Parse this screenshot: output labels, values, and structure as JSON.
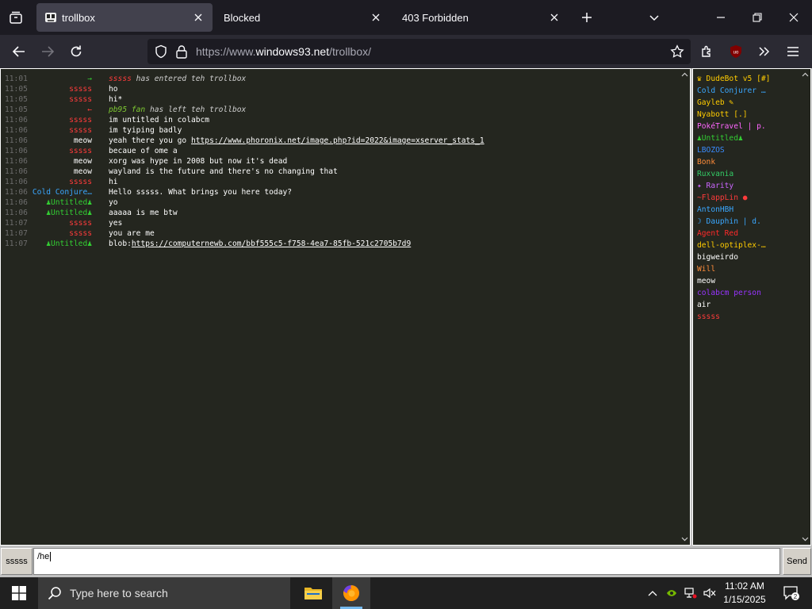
{
  "browser": {
    "tabs": [
      {
        "title": "trollbox",
        "active": true
      },
      {
        "title": "Blocked",
        "active": false
      },
      {
        "title": "403 Forbidden",
        "active": false
      }
    ],
    "url_prefix": "https://www.",
    "url_domain": "windows93.net",
    "url_path": "/trollbox/",
    "extension_badge": "uo"
  },
  "chat": {
    "messages": [
      {
        "time": "11:01",
        "nick": "→",
        "nick_color": "#33cc33",
        "body_html": "<span class='sysn' style='color:#ff3b3b'>sssss</span> <span class='sys'>has entered teh trollbox</span>"
      },
      {
        "time": "11:05",
        "nick": "sssss",
        "nick_color": "#ff3b3b",
        "body": "ho"
      },
      {
        "time": "11:05",
        "nick": "sssss",
        "nick_color": "#ff3b3b",
        "body": "hi*"
      },
      {
        "time": "11:05",
        "nick": "←",
        "nick_color": "#ff3b3b",
        "body_html": "<span class='sysn' style='color:#7ec832'>pb95 fan</span> <span class='sys'>has left teh trollbox</span>"
      },
      {
        "time": "11:06",
        "nick": "sssss",
        "nick_color": "#ff3b3b",
        "body": "im untitled in colabcm"
      },
      {
        "time": "11:06",
        "nick": "sssss",
        "nick_color": "#ff3b3b",
        "body": "im tyiping badly"
      },
      {
        "time": "11:06",
        "nick": "meow",
        "nick_color": "#ffffff",
        "body_html": "yeah there you go <a>https://www.phoronix.net/image.php?id=2022&amp;image=xserver_stats_1</a>"
      },
      {
        "time": "11:06",
        "nick": "sssss",
        "nick_color": "#ff3b3b",
        "body": "becaue of ome a"
      },
      {
        "time": "11:06",
        "nick": "meow",
        "nick_color": "#ffffff",
        "body": "xorg was hype in 2008 but now it's dead"
      },
      {
        "time": "11:06",
        "nick": "meow",
        "nick_color": "#ffffff",
        "body": "wayland is the future and there's no changing that"
      },
      {
        "time": "11:06",
        "nick": "sssss",
        "nick_color": "#ff3b3b",
        "body": "hi"
      },
      {
        "time": "11:06",
        "nick": "Cold Conjure…",
        "nick_color": "#3aa7ff",
        "body": "Hello sssss. What brings you here today?"
      },
      {
        "time": "11:06",
        "nick": "♟Untitled♟",
        "nick_color": "#33cc33",
        "body": "yo"
      },
      {
        "time": "11:06",
        "nick": "♟Untitled♟",
        "nick_color": "#33cc33",
        "body": "aaaaa is me btw"
      },
      {
        "time": "11:07",
        "nick": "sssss",
        "nick_color": "#ff3b3b",
        "body": "yes"
      },
      {
        "time": "11:07",
        "nick": "sssss",
        "nick_color": "#ff3b3b",
        "body": "you are me"
      },
      {
        "time": "11:07",
        "nick": "♟Untitled♟",
        "nick_color": "#33cc33",
        "body_html": "blob:<a>https://computernewb.com/bbf555c5-f758-4ea7-85fb-521c2705b7d9</a>"
      }
    ]
  },
  "users": [
    {
      "name": "♛ DudeBot v5 [#]",
      "color": "#ffcc00"
    },
    {
      "name": "Cold Conjurer …",
      "color": "#3aa7ff"
    },
    {
      "name": "Gayleb ✎",
      "color": "#ffcc00"
    },
    {
      "name": "Nyabott [.]",
      "color": "#ffcc00"
    },
    {
      "name": "PokéTravel | p.",
      "color": "#ff66ff"
    },
    {
      "name": "♟Untitled♟",
      "color": "#33cc33"
    },
    {
      "name": "LBOZOS",
      "color": "#3a8cff"
    },
    {
      "name": "Bonk",
      "color": "#ff8c3a"
    },
    {
      "name": "Ruxvania",
      "color": "#33cc66"
    },
    {
      "name": "✦ Rarity",
      "color": "#cc66ff"
    },
    {
      "name": "~FlappLin ●",
      "color": "#ff3b3b"
    },
    {
      "name": "AntonHBH",
      "color": "#3aa7ff"
    },
    {
      "name": "☽ Dauphin | d.",
      "color": "#3aa7ff"
    },
    {
      "name": "Agent Red",
      "color": "#ff2a2a"
    },
    {
      "name": "dell-optiplex-…",
      "color": "#ffcc00"
    },
    {
      "name": "bigweirdo",
      "color": "#ffffff"
    },
    {
      "name": "Will",
      "color": "#ff8c3a"
    },
    {
      "name": "meow",
      "color": "#ffffff"
    },
    {
      "name": "colabcm person",
      "color": "#9933ff"
    },
    {
      "name": "air",
      "color": "#ffffff"
    },
    {
      "name": "sssss",
      "color": "#ff3b3b"
    }
  ],
  "input": {
    "nick_label": "sssss",
    "value": "/he",
    "send_label": "Send"
  },
  "taskbar": {
    "search_placeholder": "Type here to search",
    "time": "11:02 AM",
    "date": "1/15/2025",
    "notification_count": "2"
  }
}
